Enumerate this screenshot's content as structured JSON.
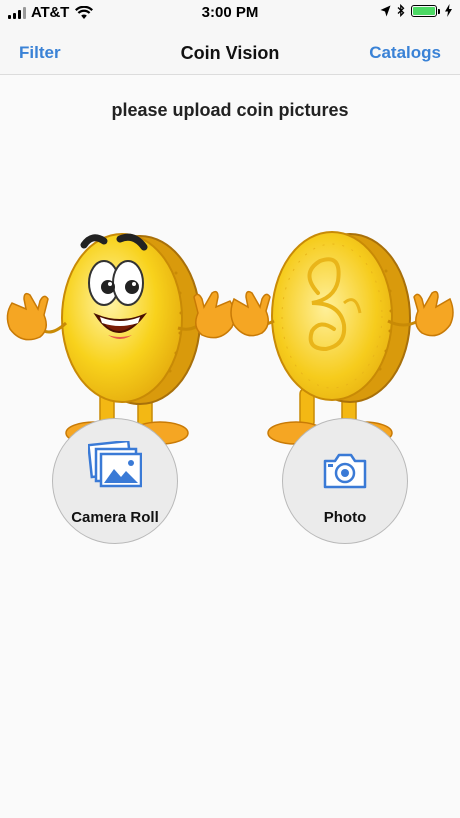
{
  "status_bar": {
    "carrier": "AT&T",
    "time": "3:00 PM",
    "icons": [
      "signal-icon",
      "wifi-icon",
      "location-icon",
      "bluetooth-icon",
      "battery-icon",
      "charging-icon"
    ],
    "battery_level": 1.0,
    "battery_color": "#4cd964"
  },
  "nav": {
    "left_label": "Filter",
    "title": "Coin Vision",
    "right_label": "Catalogs",
    "accent_color": "#3a82d6"
  },
  "main": {
    "prompt": "please upload coin pictures",
    "illustration": [
      "coin-mascot-front",
      "coin-mascot-back"
    ],
    "buttons": [
      {
        "label": "Camera Roll",
        "icon": "photo-library-icon"
      },
      {
        "label": "Photo",
        "icon": "camera-icon"
      }
    ]
  }
}
